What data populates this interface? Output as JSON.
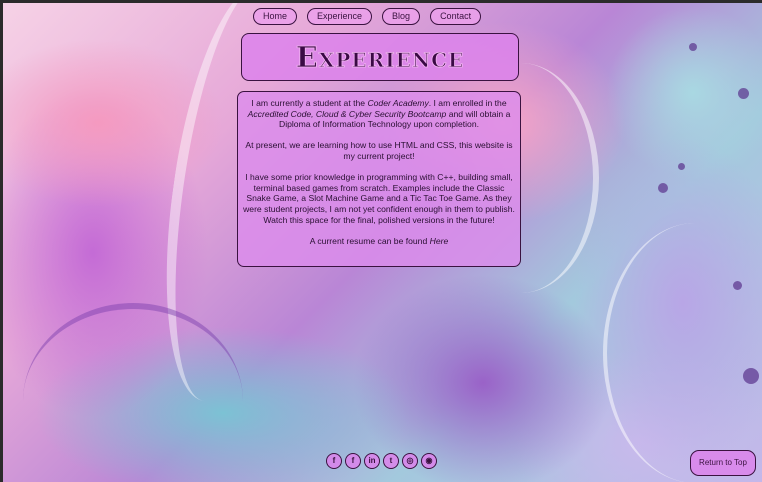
{
  "nav": {
    "items": [
      {
        "label": "Home"
      },
      {
        "label": "Experience"
      },
      {
        "label": "Blog"
      },
      {
        "label": "Contact"
      }
    ]
  },
  "page": {
    "title": "Experience"
  },
  "content": {
    "p1_intro": "I am currently a student at the ",
    "p1_school": "Coder Academy",
    "p1_mid": ". I am enrolled in the ",
    "p1_course": "Accredited Code, Cloud & Cyber Security Bootcamp",
    "p1_end": " and will obtain a Diploma of Information Technology upon completion.",
    "p2": "At present, we are learning how to use HTML and CSS, this website is my current project!",
    "p3": "I have some prior knowledge in programming with C++, building small, terminal based games from scratch. Examples include the Classic Snake Game, a Slot Machine Game and a Tic Tac Toe Game. As they were student projects, I am not yet confident enough in them to publish. Watch this space for the final, polished versions in the future!",
    "p4_text": "A current resume can be found ",
    "p4_link": "Here"
  },
  "socials": [
    {
      "icon": "facebook-icon",
      "glyph": "f"
    },
    {
      "icon": "facebook-icon",
      "glyph": "f"
    },
    {
      "icon": "linkedin-icon",
      "glyph": "in"
    },
    {
      "icon": "twitter-icon",
      "glyph": "t"
    },
    {
      "icon": "instagram-icon",
      "glyph": "◎"
    },
    {
      "icon": "github-icon",
      "glyph": "◉"
    }
  ],
  "footer": {
    "return_label": "Return to Top"
  },
  "colors": {
    "accent": "#dc82eb",
    "border": "#3a1240",
    "title": "#3a0a45"
  }
}
